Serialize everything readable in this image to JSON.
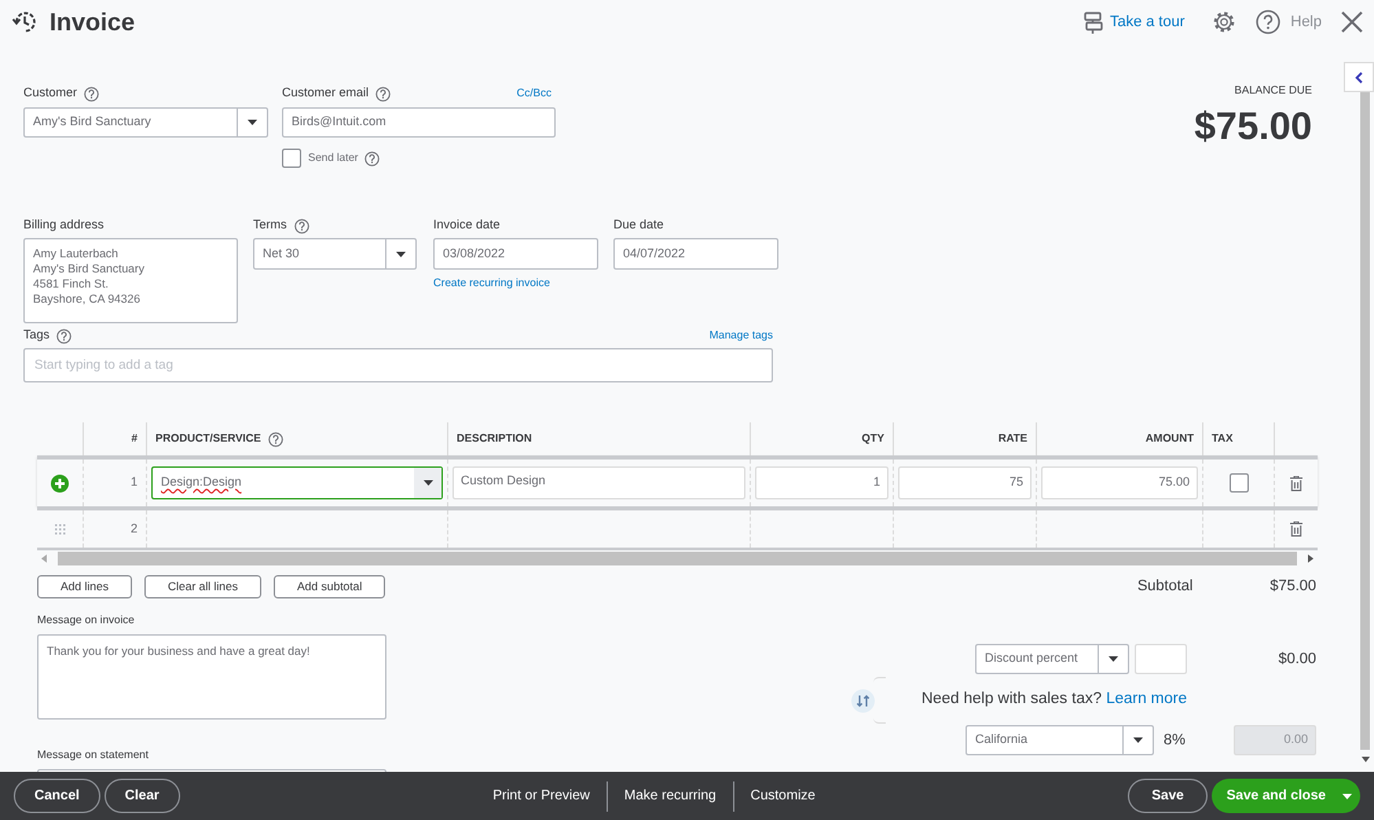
{
  "header": {
    "title": "Invoice",
    "tour_link": "Take a tour",
    "help_link": "Help"
  },
  "balance": {
    "label": "BALANCE DUE",
    "amount": "$75.00"
  },
  "customer": {
    "label": "Customer",
    "value": "Amy's Bird Sanctuary"
  },
  "email": {
    "label": "Customer email",
    "value": "Birds@Intuit.com",
    "cc_link": "Cc/Bcc"
  },
  "send_later": {
    "label": "Send later",
    "checked": false
  },
  "billing_address": {
    "label": "Billing address",
    "lines": [
      "Amy Lauterbach",
      "Amy's Bird Sanctuary",
      "4581 Finch St.",
      "Bayshore, CA  94326"
    ]
  },
  "terms": {
    "label": "Terms",
    "value": "Net 30"
  },
  "invoice_date": {
    "label": "Invoice date",
    "value": "03/08/2022",
    "link": "Create recurring invoice"
  },
  "due_date": {
    "label": "Due date",
    "value": "04/07/2022"
  },
  "tags": {
    "label": "Tags",
    "manage_link": "Manage tags",
    "placeholder": "Start typing to add a tag"
  },
  "table": {
    "columns": [
      "#",
      "PRODUCT/SERVICE",
      "DESCRIPTION",
      "QTY",
      "RATE",
      "AMOUNT",
      "TAX"
    ],
    "rows": [
      {
        "number": "1",
        "selected": true,
        "product": "Design:Design",
        "description": "Custom Design",
        "qty": "1",
        "rate": "75",
        "amount": "75.00",
        "tax": false
      },
      {
        "number": "2",
        "selected": false
      }
    ]
  },
  "line_actions": [
    "Add lines",
    "Clear all lines",
    "Add subtotal"
  ],
  "subtotal": {
    "label": "Subtotal",
    "value": "$75.00"
  },
  "message_invoice": {
    "label": "Message on invoice",
    "value": "Thank you for your business and have a great day!"
  },
  "message_statement": {
    "label": "Message on statement"
  },
  "discount": {
    "type": "Discount percent",
    "value": "$0.00"
  },
  "sales_tax_help": {
    "text": "Need help with sales tax?",
    "link": "Learn more"
  },
  "sales_tax": {
    "region": "California",
    "rate": "8%",
    "amount": "0.00"
  },
  "footer": {
    "left": [
      "Cancel",
      "Clear"
    ],
    "center": [
      "Print or Preview",
      "Make recurring",
      "Customize"
    ],
    "save": "Save",
    "save_close": "Save and close"
  }
}
